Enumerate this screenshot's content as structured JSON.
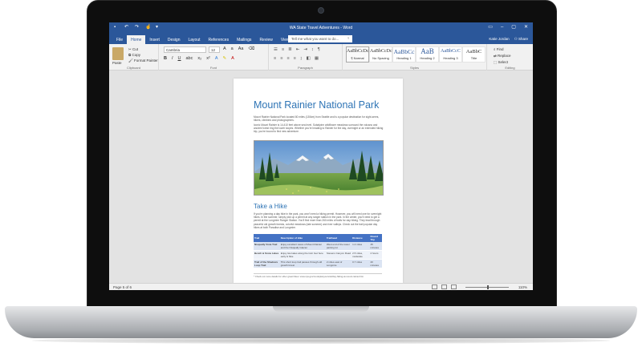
{
  "window": {
    "title": "WA State Travel Adventures - Word",
    "quick_access_icons": [
      "save-icon",
      "undo-icon",
      "redo-icon",
      "touch-mode-icon",
      "customize-icon"
    ]
  },
  "ribbon": {
    "tabs": [
      "File",
      "Home",
      "Insert",
      "Design",
      "Layout",
      "References",
      "Mailings",
      "Review",
      "View"
    ],
    "active_tab": "Home",
    "tell_me_placeholder": "Tell me what you want to do...",
    "user": "Katie Jordan",
    "share_label": "Share",
    "clipboard": {
      "paste_label": "Paste",
      "cut_label": "Cut",
      "copy_label": "Copy",
      "format_painter_label": "Format Painter",
      "group_label": "Clipboard"
    },
    "font": {
      "font_name": "Cambria",
      "font_size": "12",
      "group_label": "Font"
    },
    "paragraph": {
      "group_label": "Paragraph"
    },
    "styles": {
      "items": [
        {
          "preview": "AaBbCcDc",
          "name": "¶ Normal"
        },
        {
          "preview": "AaBbCcDc",
          "name": "No Spacing"
        },
        {
          "preview": "AaBbCc",
          "name": "Heading 1"
        },
        {
          "preview": "AaB",
          "name": "Heading 2"
        },
        {
          "preview": "AaBbCcC",
          "name": "Heading 3"
        },
        {
          "preview": "AaBbC",
          "name": "Title"
        }
      ],
      "group_label": "Styles"
    },
    "editing": {
      "find_label": "Find",
      "replace_label": "Replace",
      "select_label": "Select",
      "group_label": "Editing"
    }
  },
  "document": {
    "title": "Mount Rainier National Park",
    "para1": "Mount Rainier National Park located 80 miles (130km) from Seattle and is a popular destination for sight-seers, hikers, climbers and photographers.",
    "para2": "Iconic Mount Rainier is 14,410 feet above sea level. Subalpine wildflower meadows surround the volcano and ancient forest ring the lower slopes. Whether you're heading to Rainier for the day, overnight or an extended hiking trip, you're bound to find new adventure.",
    "heading2": "Take a Hike",
    "para3": "If you're planning a day hike in the park, you won't need a hiking permit. However, you will need one for overnight hikes. In the summer, simply pick up a permit at any ranger station in the park. In the winter, you'll need to get a permit at the Longmire Ranger Station. You'll find more than 260 miles of trails for day hiking. They lead through peaceful old growth forests, colorful meadows (late summer) and river valleys. Check out the trail popular day hikes at both Paradise and Longmire.",
    "table": {
      "headers": [
        "Trail",
        "Description of Hike",
        "Trailhead",
        "Distance",
        "Round Trip"
      ],
      "rows": [
        [
          "Nisqually Vista Trail",
          "Enjoy excellent views of Mount Rainier and the Nisqually Glacier",
          "West end of the lower parking lot",
          "1.2 miles",
          "45 minutes"
        ],
        [
          "Bench & Snow Lakes",
          "Enjoy two lakes along the trail. Get here early & hike",
          "Stevens Canyon Road",
          "2.5 miles, moderate",
          "2 hours"
        ],
        [
          "Trail of the Shadows Loop Trail",
          "This short loop trail passes through old growth forest",
          "2 miles east of Longmire",
          "0.7 miles",
          "20 minutes"
        ]
      ]
    },
    "footnote": "* Check out more details for other great hikes: www.nps.gov/mora/planyourvisit/day-hiking-at-mount-rainier.htm"
  },
  "status": {
    "page": "Page 5 of 6",
    "zoom": "110%"
  }
}
